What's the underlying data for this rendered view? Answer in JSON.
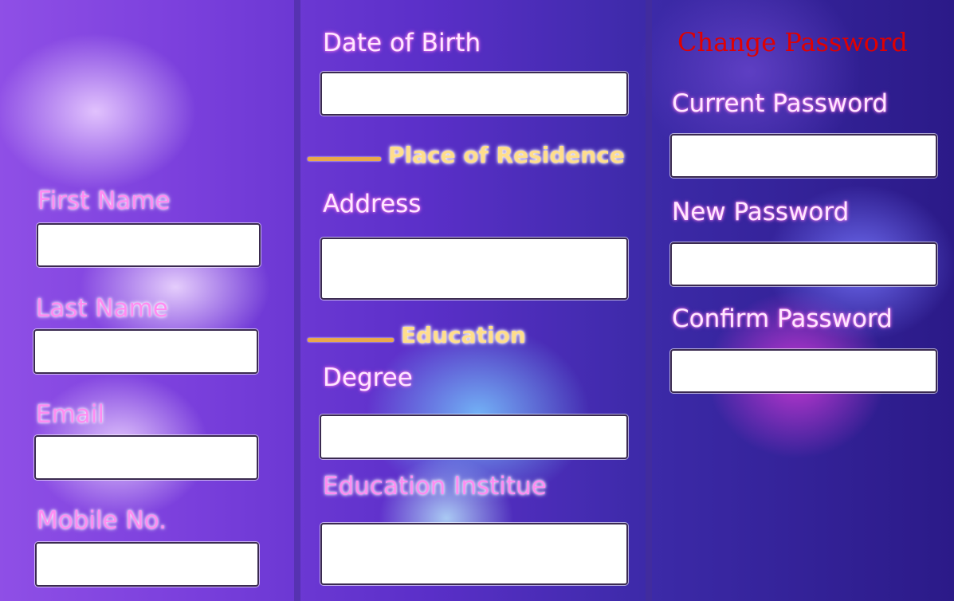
{
  "personal": {
    "first_name": {
      "label": "First Name",
      "value": ""
    },
    "last_name": {
      "label": "Last Name",
      "value": ""
    },
    "email": {
      "label": "Email",
      "value": ""
    },
    "mobile": {
      "label": "Mobile No.",
      "value": ""
    }
  },
  "middle": {
    "dob": {
      "label": "Date of Birth",
      "value": ""
    },
    "residence_heading": "Place of Residence",
    "address": {
      "label": "Address",
      "value": ""
    },
    "education_heading": "Education",
    "degree": {
      "label": "Degree",
      "value": ""
    },
    "institute": {
      "label": "Education Institue",
      "value": ""
    }
  },
  "password": {
    "title": "Change Password",
    "current": {
      "label": "Current Password",
      "value": ""
    },
    "new": {
      "label": "New Password",
      "value": ""
    },
    "confirm": {
      "label": "Confirm Password",
      "value": ""
    }
  },
  "colors": {
    "section_heading": "#ffde8c",
    "section_rule": "#e9a84c",
    "title": "#e00000",
    "label_pink": "#ff8cf2"
  }
}
